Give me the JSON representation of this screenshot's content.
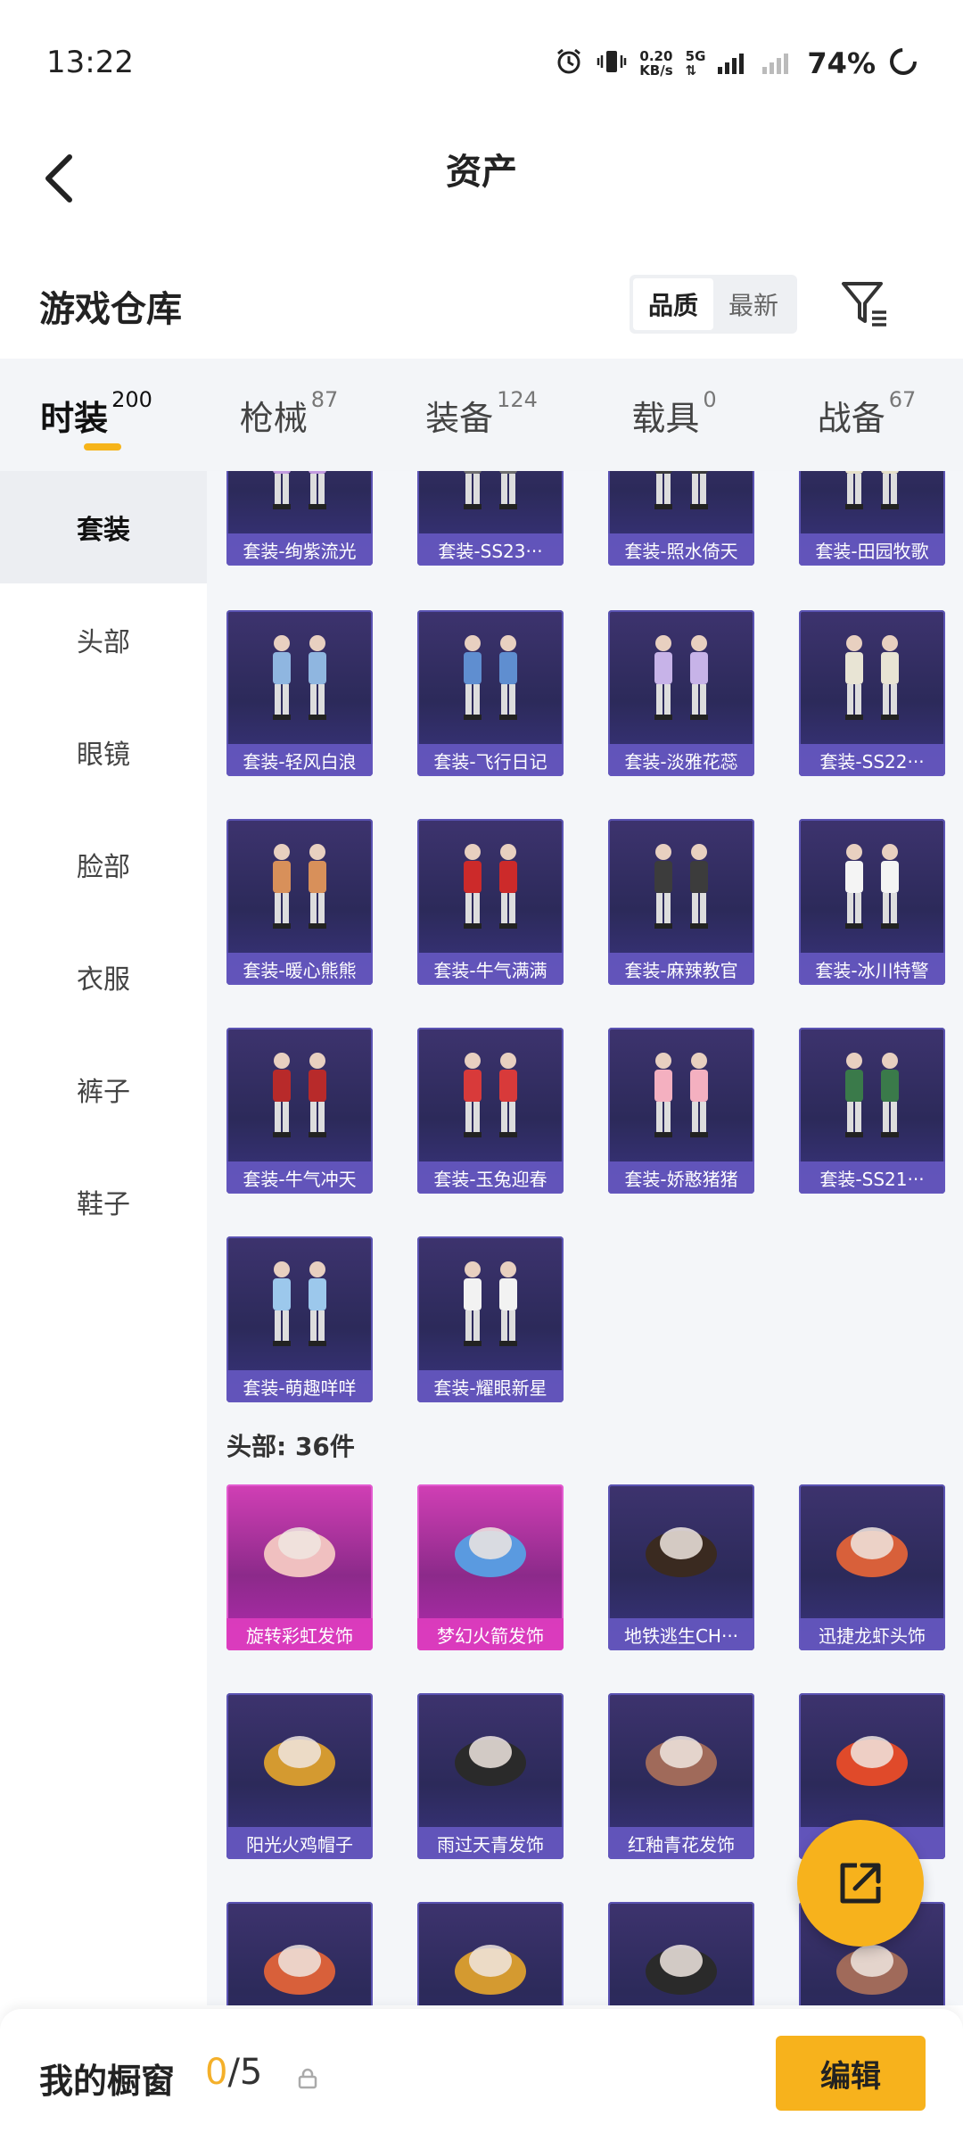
{
  "status_bar": {
    "time": "13:22",
    "speed_value": "0.20",
    "speed_unit": "KB/s",
    "network": "5G",
    "battery": "74%"
  },
  "header": {
    "title": "资产"
  },
  "warehouse": {
    "title": "游戏仓库",
    "sort_options": [
      "品质",
      "最新"
    ],
    "sort_active": "品质"
  },
  "category_tabs": [
    {
      "label": "时装",
      "count": "200",
      "active": true
    },
    {
      "label": "枪械",
      "count": "87"
    },
    {
      "label": "装备",
      "count": "124"
    },
    {
      "label": "载具",
      "count": "0"
    },
    {
      "label": "战备",
      "count": "67"
    }
  ],
  "sidebar": [
    {
      "label": "套装",
      "active": true
    },
    {
      "label": "头部"
    },
    {
      "label": "眼镜"
    },
    {
      "label": "脸部"
    },
    {
      "label": "衣服"
    },
    {
      "label": "裤子"
    },
    {
      "label": "鞋子"
    }
  ],
  "suits": [
    "套装-绚紫流光",
    "套装-SS23···",
    "套装-照水倚天",
    "套装-田园牧歌",
    "套装-轻风白浪",
    "套装-飞行日记",
    "套装-淡雅花蕊",
    "套装-SS22···",
    "套装-暖心熊熊",
    "套装-牛气满满",
    "套装-麻辣教官",
    "套装-冰川特警",
    "套装-牛气冲天",
    "套装-玉兔迎春",
    "套装-娇憨猪猪",
    "套装-SS21···",
    "套装-萌趣咩咩",
    "套装-耀眼新星"
  ],
  "head_section": {
    "label": "头部: 36件"
  },
  "head_items": [
    {
      "name": "旋转彩虹发饰",
      "rarity": "pink"
    },
    {
      "name": "梦幻火箭发饰",
      "rarity": "pink"
    },
    {
      "name": "地铁逃生CH···",
      "rarity": "purple"
    },
    {
      "name": "迅捷龙虾头饰",
      "rarity": "purple"
    },
    {
      "name": "阳光火鸡帽子",
      "rarity": "purple"
    },
    {
      "name": "雨过天青发饰",
      "rarity": "purple"
    },
    {
      "name": "红釉青花发饰",
      "rarity": "purple"
    },
    {
      "name": "饰",
      "rarity": "purple"
    }
  ],
  "bottom_bar": {
    "label": "我的橱窗",
    "count_current": "0",
    "count_total": "/5",
    "edit_label": "编辑"
  },
  "colors": {
    "accent": "#f7b21c",
    "card_purple": "#3d336e",
    "card_pink": "#d13fb5"
  }
}
